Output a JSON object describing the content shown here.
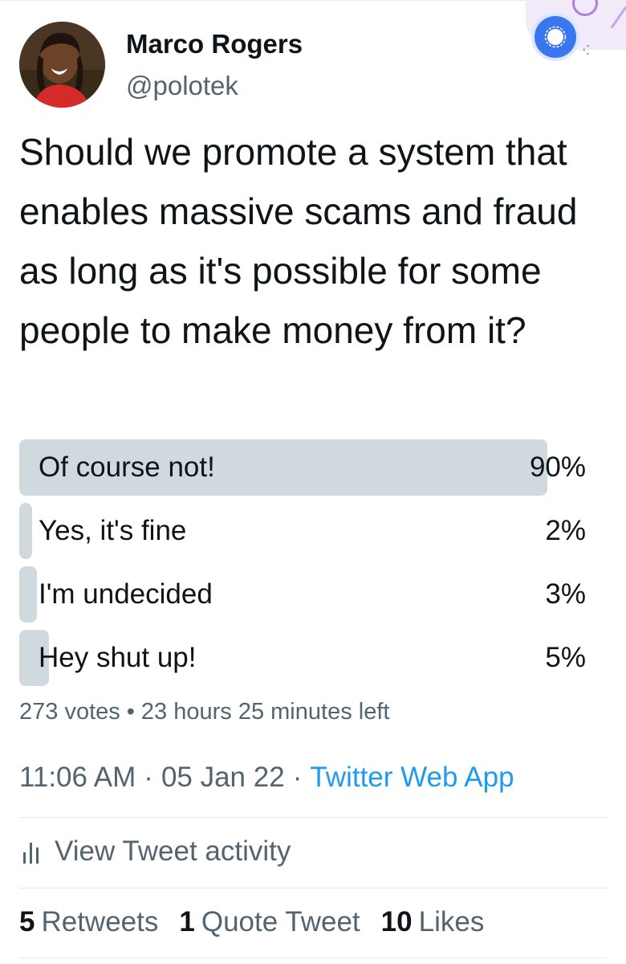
{
  "author": {
    "display_name": "Marco Rogers",
    "handle": "@polotek"
  },
  "tweet": {
    "text": "Should we promote a system that enables massive scams and fraud as long as it's possible for some people to make money from it?"
  },
  "poll": {
    "options": [
      {
        "label": "Of course not!",
        "percent_text": "90%",
        "percent": 90,
        "winner": true
      },
      {
        "label": "Yes, it's fine",
        "percent_text": "2%",
        "percent": 2,
        "winner": false
      },
      {
        "label": "I'm undecided",
        "percent_text": "3%",
        "percent": 3,
        "winner": false
      },
      {
        "label": "Hey shut up!",
        "percent_text": "5%",
        "percent": 5,
        "winner": false
      }
    ],
    "votes": "273 votes",
    "separator": "•",
    "time_left": "23 hours 25 minutes left"
  },
  "meta": {
    "time": "11:06 AM",
    "separator": "·",
    "date": "05 Jan 22",
    "source": "Twitter Web App"
  },
  "activity": {
    "label": "View Tweet activity",
    "icon": "bar-chart-icon"
  },
  "stats": {
    "retweets_count": "5",
    "retweets_label": "Retweets",
    "quotes_count": "1",
    "quotes_label": "Quote Tweet",
    "likes_count": "10",
    "likes_label": "Likes"
  },
  "colors": {
    "bar": "#cfd9de",
    "link": "#1d9bf0",
    "secondary_text": "#536471",
    "signal_blue": "#3a76f0"
  }
}
